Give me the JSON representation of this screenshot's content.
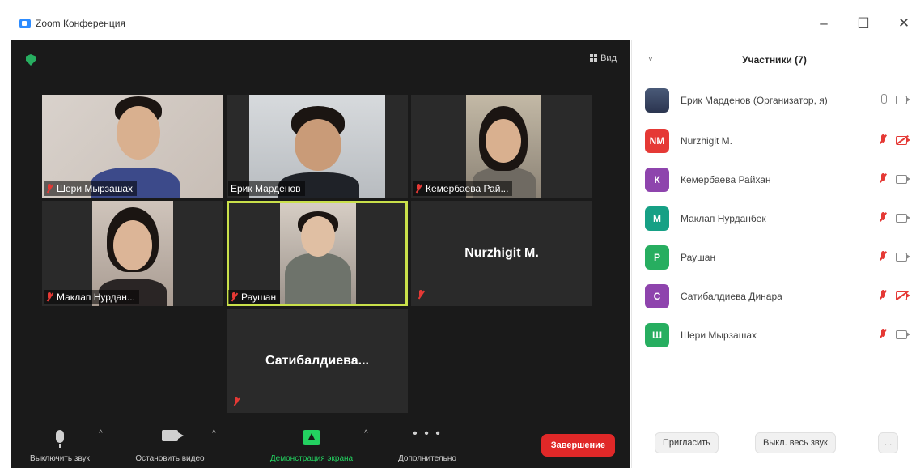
{
  "window": {
    "title": "Zoom Конференция",
    "minimize": "–",
    "maximize": "☐",
    "close": "✕"
  },
  "meeting": {
    "view_label": "Вид",
    "tiles": [
      {
        "name": "Шери Мырзашах",
        "muted": true
      },
      {
        "name": "Ерик Марденов",
        "muted": false
      },
      {
        "name": "Кемербаева Рай...",
        "muted": true
      },
      {
        "name": "Маклап Нурдан...",
        "muted": true
      },
      {
        "name": "Раушан",
        "muted": true,
        "active": true
      },
      {
        "name": "Nurzhigit M.",
        "muted": true,
        "video_off": true
      },
      {
        "name": "Сатибалдиева...",
        "muted": true,
        "video_off": true
      }
    ]
  },
  "toolbar": {
    "mute_label": "Выключить звук",
    "video_label": "Остановить видео",
    "share_label": "Демонстрация экрана",
    "more_label": "Дополнительно",
    "end_label": "Завершение",
    "caret": "^",
    "more_glyph": "• • •",
    "colors": {
      "share": "#23d160",
      "end": "#e02828"
    }
  },
  "participants": {
    "title": "Участники (7)",
    "collapse_glyph": "˅",
    "list": [
      {
        "initials": "",
        "name": "Ерик Марденов (Организатор, я)",
        "avatar_color": "photo",
        "mic": "on",
        "cam": "on"
      },
      {
        "initials": "NM",
        "name": "Nurzhigit M.",
        "avatar_color": "#e53935",
        "mic": "off",
        "cam": "off"
      },
      {
        "initials": "К",
        "name": "Кемербаева Райхан",
        "avatar_color": "#8e44ad",
        "mic": "off",
        "cam": "on"
      },
      {
        "initials": "М",
        "name": "Маклап Нурданбек",
        "avatar_color": "#16a085",
        "mic": "off",
        "cam": "on"
      },
      {
        "initials": "Р",
        "name": "Раушан",
        "avatar_color": "#27ae60",
        "mic": "off",
        "cam": "on"
      },
      {
        "initials": "С",
        "name": "Сатибалдиева Динара",
        "avatar_color": "#8e44ad",
        "mic": "off",
        "cam": "off"
      },
      {
        "initials": "Ш",
        "name": "Шери Мырзашах",
        "avatar_color": "#27ae60",
        "mic": "off",
        "cam": "on"
      }
    ],
    "invite_label": "Пригласить",
    "mute_all_label": "Выкл. весь звук",
    "more_label": "..."
  }
}
